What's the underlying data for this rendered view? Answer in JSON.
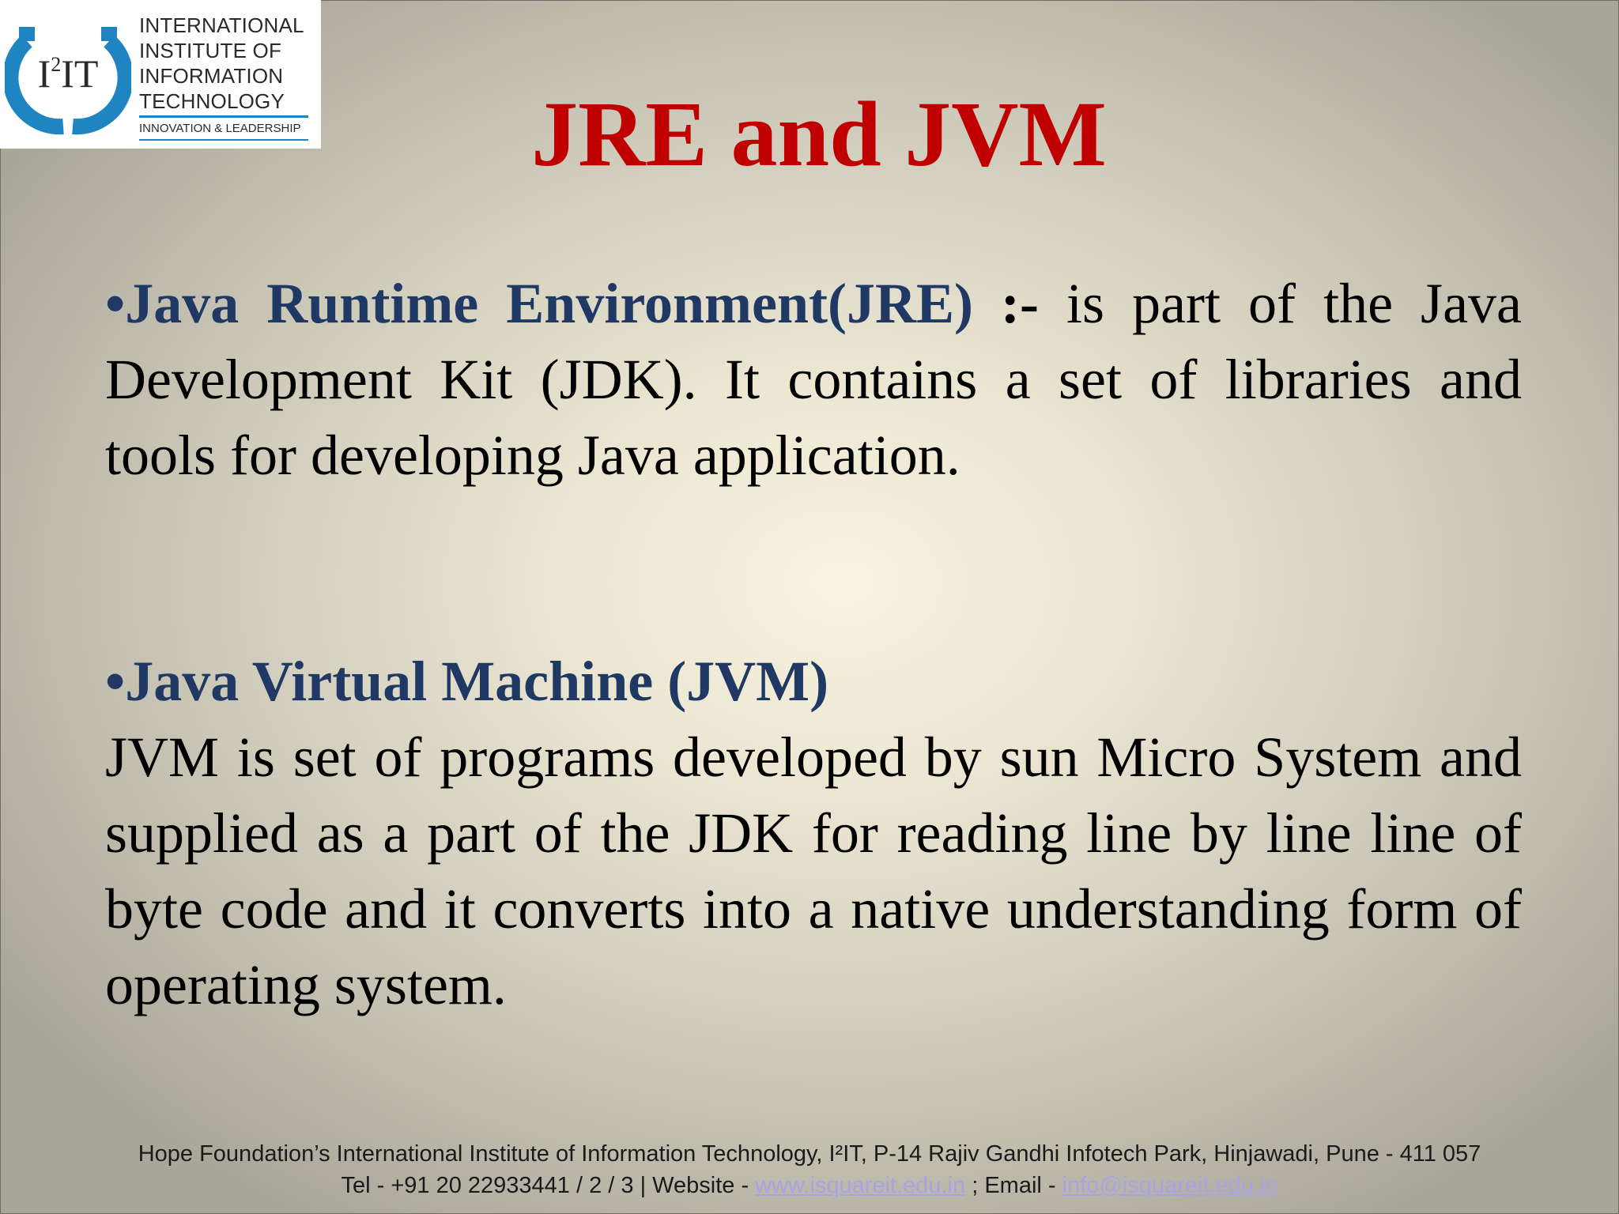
{
  "logo": {
    "mark_text": "I²IT",
    "lines": [
      "INTERNATIONAL",
      "INSTITUTE OF",
      "INFORMATION",
      "TECHNOLOGY"
    ],
    "tagline": "INNOVATION & LEADERSHIP",
    "colors": {
      "ring": "#1f84c2",
      "text": "#2a2a2a"
    }
  },
  "slide": {
    "title": "JRE and JVM",
    "sections": [
      {
        "bullet": "•",
        "heading": "Java Runtime Environment(JRE)",
        "separator": " :-",
        "text": " is part of the Java Development Kit (JDK). It contains a set of libraries and tools for developing Java application."
      },
      {
        "bullet": "•",
        "heading": "Java Virtual Machine (JVM)",
        "text": "JVM is set of programs developed by sun Micro System and supplied as a part of the JDK for reading line by line line of byte code and it converts into a native understanding form of operating system."
      }
    ],
    "colors": {
      "title": "#c00000",
      "heading": "#1f3864",
      "body": "#000000"
    }
  },
  "footer": {
    "line1": "Hope Foundation’s International Institute of Information Technology, I²IT, P-14 Rajiv Gandhi Infotech Park, Hinjawadi, Pune - 411 057",
    "line2_prefix": "Tel - +91 20 22933441 / 2 / 3  |  Website - ",
    "website": "www.isquareit.edu.in",
    "email_prefix": " ; Email - ",
    "email": "info@isquareit.edu.in",
    "link_color": "#a9a3e6"
  }
}
